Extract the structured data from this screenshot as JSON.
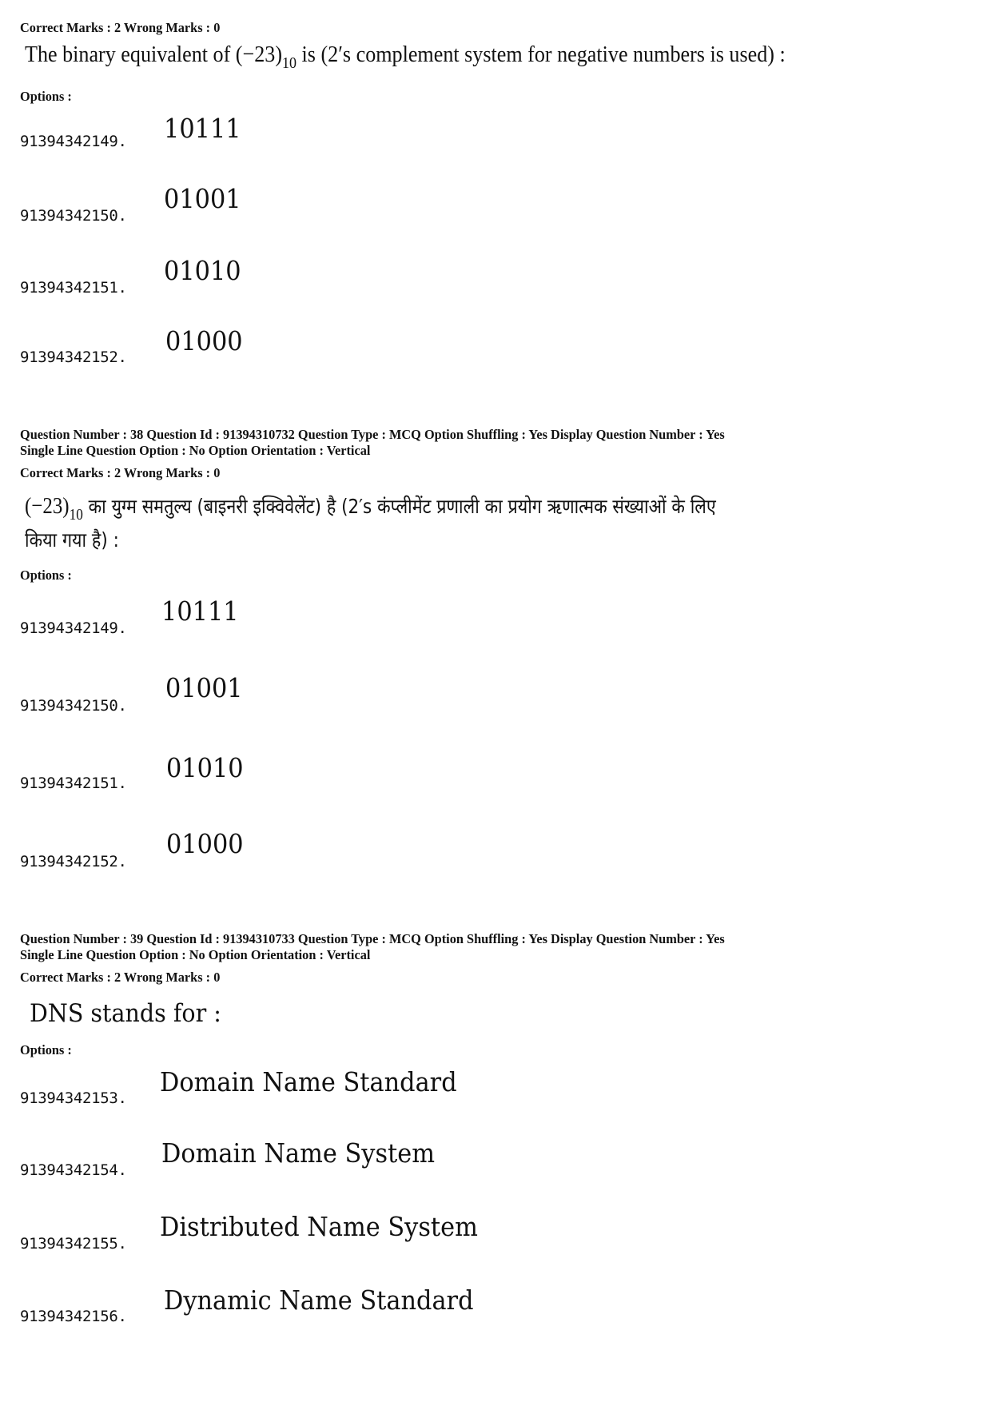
{
  "q37": {
    "marks": "Correct Marks : 2  Wrong Marks : 0",
    "text_pre": "The binary equivalent of (−23)",
    "text_sub": "10",
    "text_post": " is (2′s complement system for negative numbers is used) :",
    "options_label": "Options :",
    "options": [
      {
        "id": "91394342149.",
        "value": "10111"
      },
      {
        "id": "91394342150.",
        "value": "01001"
      },
      {
        "id": "91394342151.",
        "value": "01010"
      },
      {
        "id": "91394342152.",
        "value": "01000"
      }
    ]
  },
  "q38": {
    "meta_line1": "Question Number : 38  Question Id : 91394310732  Question Type : MCQ  Option Shuffling : Yes  Display Question Number : Yes",
    "meta_line2": "Single Line Question Option : No  Option Orientation : Vertical",
    "marks": "Correct Marks : 2  Wrong Marks : 0",
    "text_pre": "(−23)",
    "text_sub": "10",
    "text_line1_post": " का युग्म समतुल्य (बाइनरी इक्विवेलेंट) है (2′s कंप्लीमेंट प्रणाली का प्रयोग ऋणात्मक संख्याओं के लिए",
    "text_line2": "किया गया है) :",
    "options_label": "Options :",
    "options": [
      {
        "id": "91394342149.",
        "value": "10111"
      },
      {
        "id": "91394342150.",
        "value": "01001"
      },
      {
        "id": "91394342151.",
        "value": "01010"
      },
      {
        "id": "91394342152.",
        "value": "01000"
      }
    ]
  },
  "q39": {
    "meta_line1": "Question Number : 39  Question Id : 91394310733  Question Type : MCQ  Option Shuffling : Yes  Display Question Number : Yes",
    "meta_line2": "Single Line Question Option : No  Option Orientation : Vertical",
    "marks": "Correct Marks : 2  Wrong Marks : 0",
    "text": "DNS stands for :",
    "options_label": "Options :",
    "options": [
      {
        "id": "91394342153.",
        "value": "Domain Name Standard"
      },
      {
        "id": "91394342154.",
        "value": "Domain Name System"
      },
      {
        "id": "91394342155.",
        "value": "Distributed Name System"
      },
      {
        "id": "91394342156.",
        "value": "Dynamic Name Standard"
      }
    ]
  }
}
